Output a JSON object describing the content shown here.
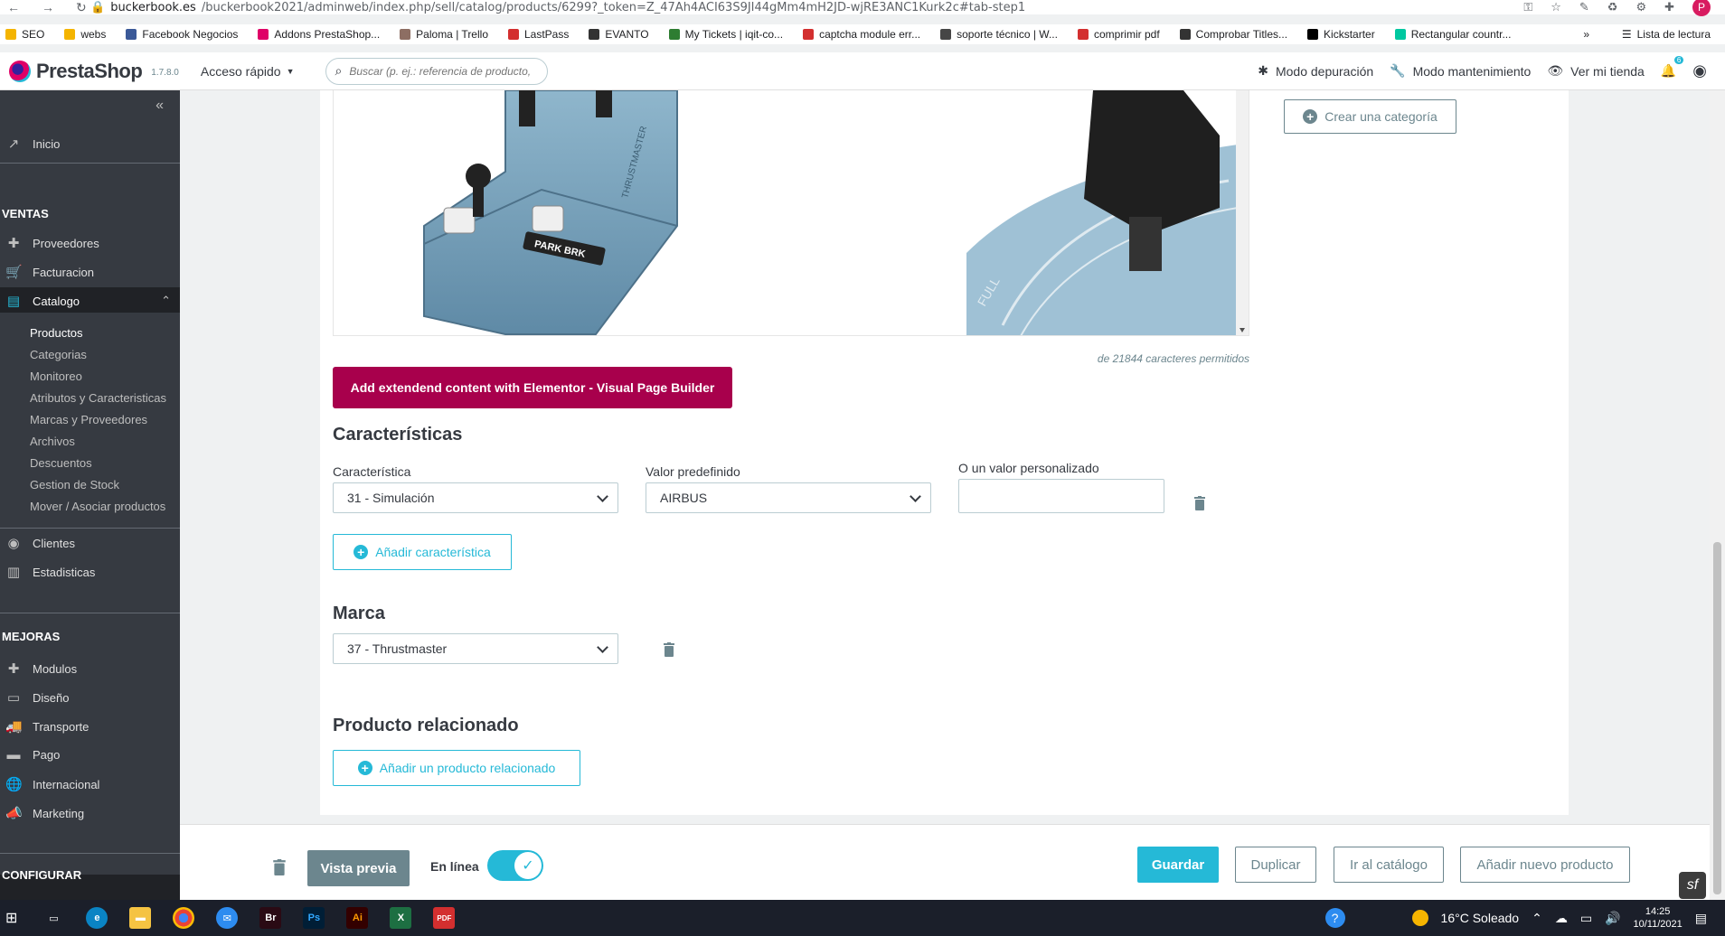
{
  "browser": {
    "url_host": "buckerbook.es",
    "url_path": "/buckerbook2021/adminweb/index.php/sell/catalog/products/6299?_token=Z_47Ah4ACI63S9JI44gMm4mH2JD-wjRE3ANC1Kurk2c#tab-step1",
    "bookmarks": [
      "SEO",
      "webs",
      "Facebook Negocios",
      "Addons PrestaShop...",
      "Paloma | Trello",
      "LastPass",
      "EVANTO",
      "My Tickets | iqit-co...",
      "captcha module err...",
      "soporte técnico | W...",
      "comprimir pdf",
      "Comprobar Titles...",
      "Kickstarter",
      "Rectangular countr..."
    ],
    "bookmark_colors": [
      "#f4b400",
      "#f4b400",
      "#3b5998",
      "#df0067",
      "#8d6e63",
      "#d32f2f",
      "#333333",
      "#2e7d32",
      "#d32f2f",
      "#464646",
      "#d32f2f",
      "#333333",
      "#000000",
      "#00c8a0"
    ],
    "more": "»",
    "reading_list": "Lista de lectura",
    "profile_initial": "P"
  },
  "header": {
    "brand": "PrestaShop",
    "version": "1.7.8.0",
    "quick_access": "Acceso rápido",
    "search_placeholder": "Buscar (p. ej.: referencia de producto,",
    "debug": "Modo depuración",
    "maintenance": "Modo mantenimiento",
    "view_store": "Ver mi tienda",
    "notif_count": "6"
  },
  "sidebar": {
    "home": "Inicio",
    "sales_section": "VENTAS",
    "sales": [
      "Proveedores",
      "Facturacion",
      "Catalogo"
    ],
    "catalog_sub": [
      "Productos",
      "Categorias",
      "Monitoreo",
      "Atributos y Caracteristicas",
      "Marcas y Proveedores",
      "Archivos",
      "Descuentos",
      "Gestion de Stock",
      "Mover / Asociar productos"
    ],
    "customers": "Clientes",
    "stats": "Estadisticas",
    "improve_section": "MEJORAS",
    "improve": [
      "Modulos",
      "Diseño",
      "Transporte",
      "Pago",
      "Internacional",
      "Marketing"
    ],
    "config_section": "CONFIGURAR"
  },
  "main": {
    "chars_allowed": "de 21844 caracteres permitidos",
    "elementor_button": "Add extendend content with Elementor - Visual Page Builder",
    "create_category": "Crear una categoría",
    "features_title": "Características",
    "feature_label": "Característica",
    "feature_value": "31 - Simulación",
    "preset_label": "Valor predefinido",
    "preset_value": "AIRBUS",
    "custom_label": "O un valor personalizado",
    "custom_value": "",
    "add_feature": "Añadir característica",
    "brand_title": "Marca",
    "brand_value": "37 - Thrustmaster",
    "related_title": "Producto relacionado",
    "add_related": "Añadir un producto relacionado",
    "image_texts": [
      "PARK BRK",
      "FULL",
      "THRUSTMASTER"
    ]
  },
  "footer": {
    "preview": "Vista previa",
    "online": "En línea",
    "online_enabled": true,
    "save": "Guardar",
    "duplicate": "Duplicar",
    "to_catalog": "Ir al catálogo",
    "add_new": "Añadir nuevo producto"
  },
  "taskbar": {
    "apps": [
      "Br",
      "Ps",
      "Ai",
      "X",
      "PDF"
    ],
    "weather": "16°C Soleado",
    "time": "14:25",
    "date": "10/11/2021"
  },
  "colors": {
    "accent": "#25b9d7",
    "elementor": "#a8004c",
    "sidebar_bg": "#363a41"
  }
}
